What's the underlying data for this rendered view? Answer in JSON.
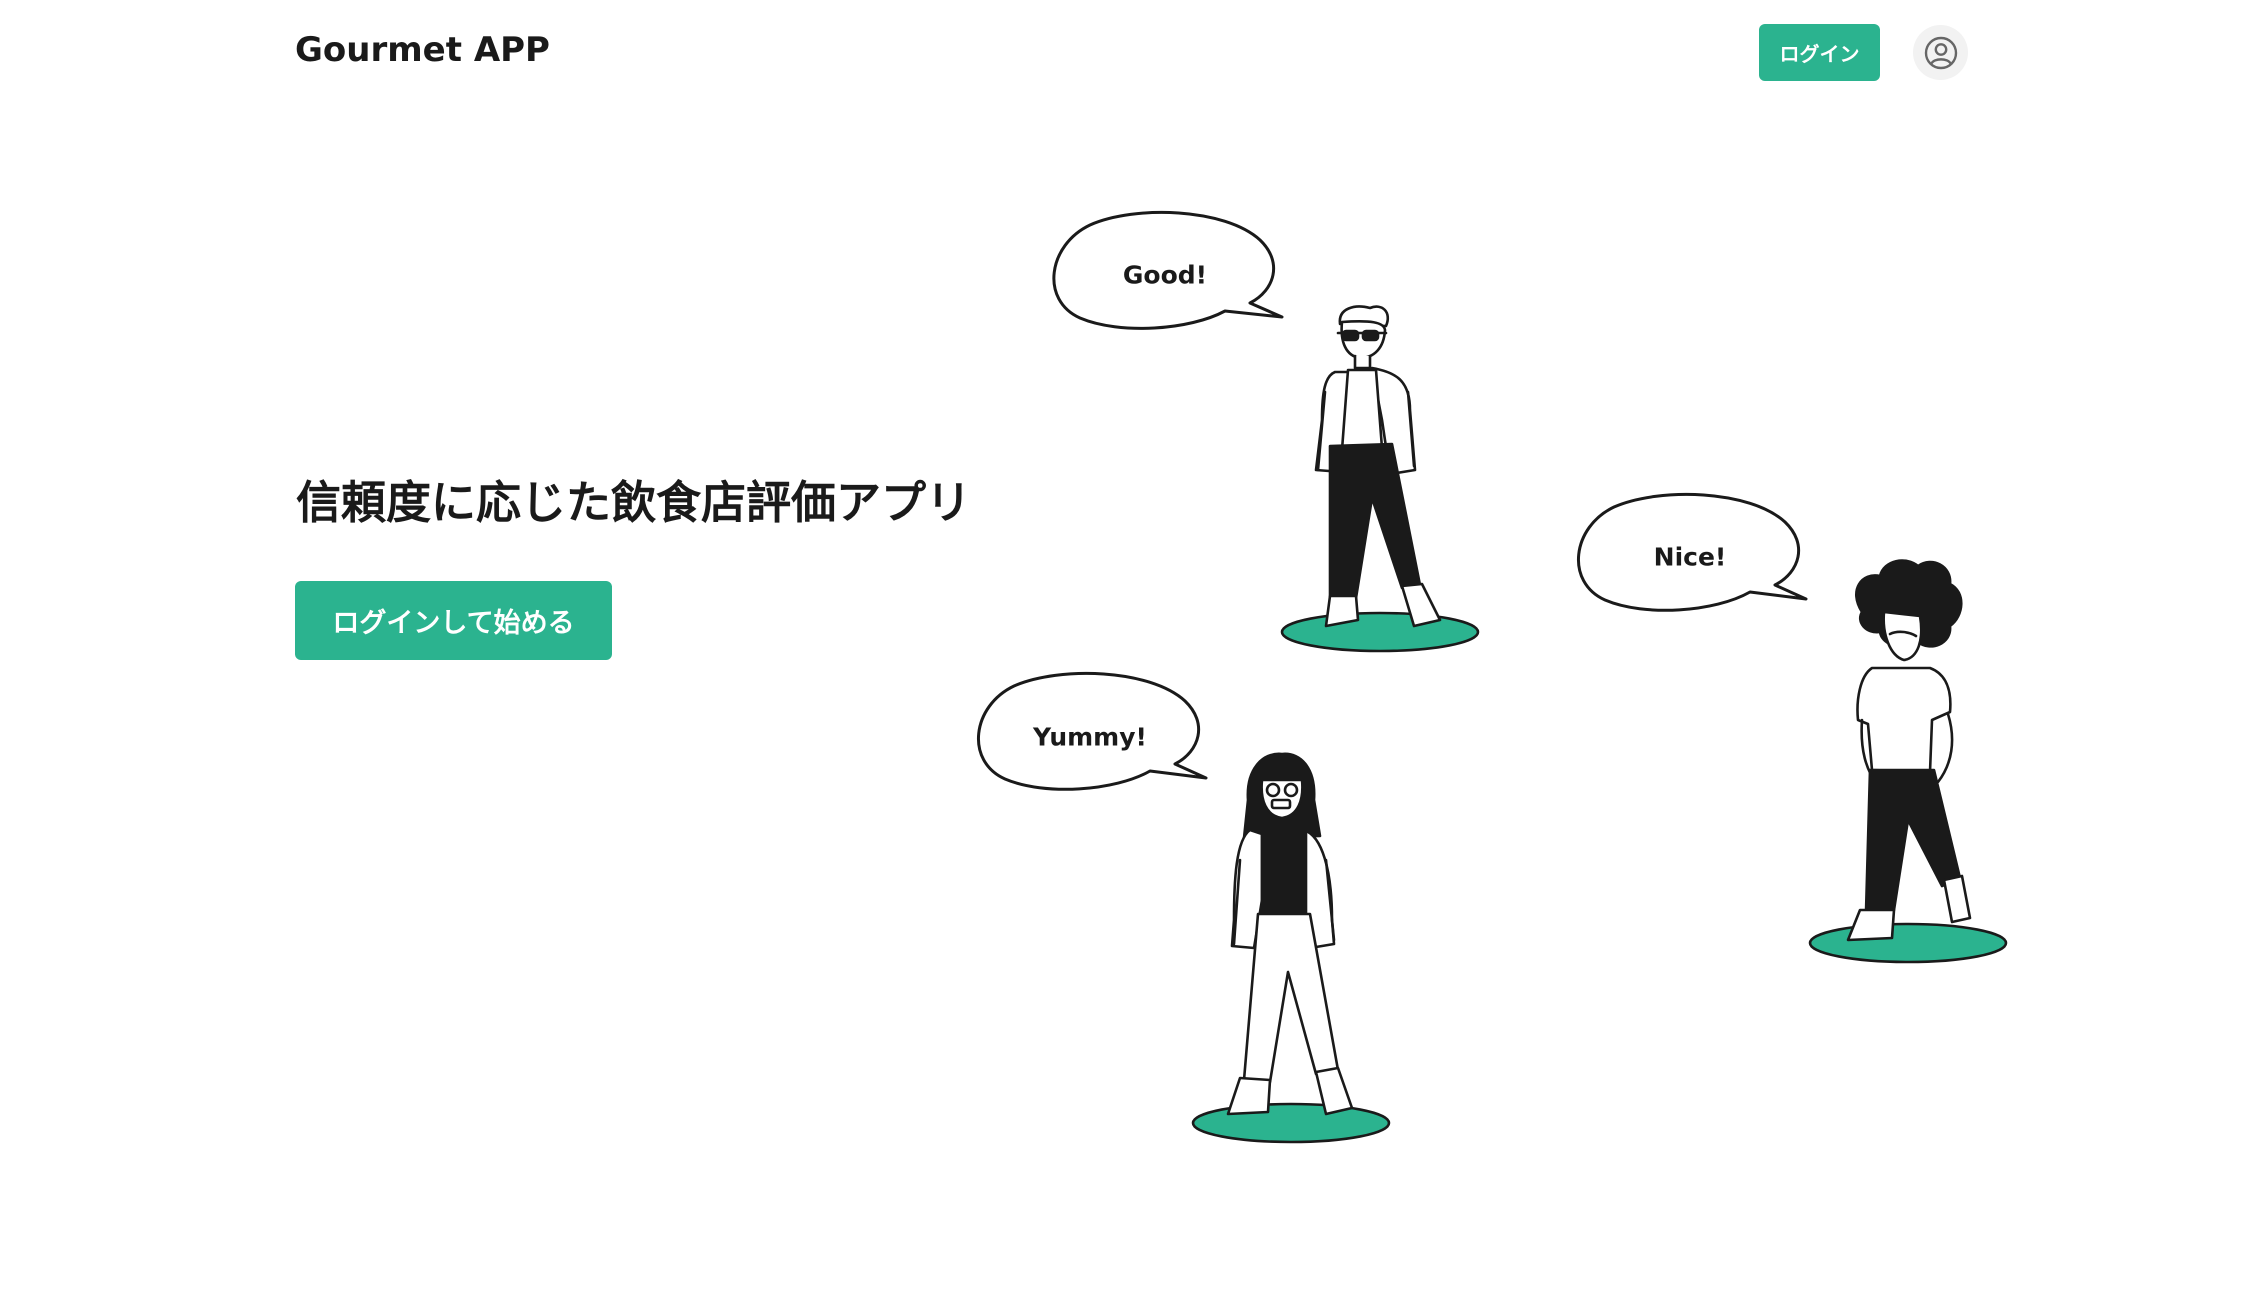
{
  "header": {
    "brand": "Gourmet APP",
    "login_label": "ログイン",
    "avatar_icon": "user-circle-icon"
  },
  "hero": {
    "title": "信頼度に応じた飲食店評価アプリ",
    "cta_label": "ログインして始める"
  },
  "illustration": {
    "bubbles": {
      "good": "Good!",
      "nice": "Nice!",
      "yummy": "Yummy!"
    }
  },
  "colors": {
    "accent": "#2bb38f",
    "text": "#1a1a1a",
    "avatar_bg": "#f2f2f2"
  }
}
